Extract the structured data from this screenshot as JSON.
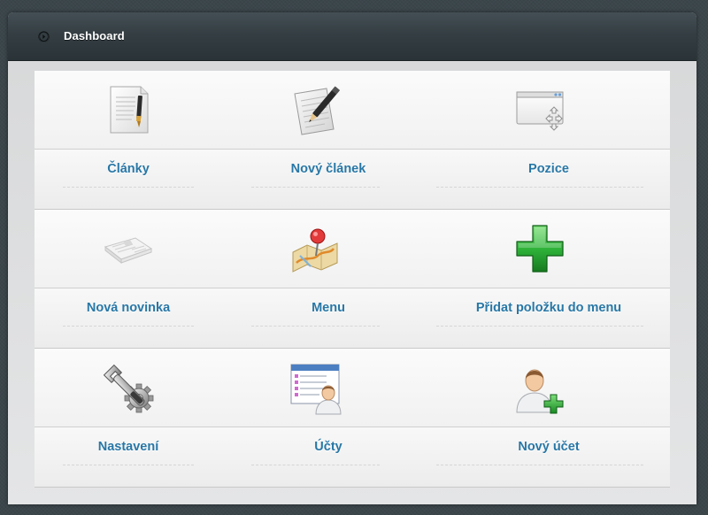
{
  "header": {
    "title": "Dashboard",
    "icon": "circle-arrow-icon"
  },
  "colors": {
    "header_bg": "#343e43",
    "link": "#2877a6",
    "page_bg": "#3b464b"
  },
  "tiles": [
    [
      {
        "name": "clanky",
        "label": "Články",
        "icon": "document-pen-icon"
      },
      {
        "name": "novy-clanek",
        "label": "Nový článek",
        "icon": "notepad-pencil-icon"
      },
      {
        "name": "pozice",
        "label": "Pozice",
        "icon": "window-arrows-icon"
      }
    ],
    [
      {
        "name": "nova-novinka",
        "label": "Nová novinka",
        "icon": "newspaper-icon"
      },
      {
        "name": "menu",
        "label": "Menu",
        "icon": "map-pin-icon"
      },
      {
        "name": "pridat-polozku",
        "label": "Přidat položku do menu",
        "icon": "green-plus-icon"
      }
    ],
    [
      {
        "name": "nastaveni",
        "label": "Nastavení",
        "icon": "wrench-gear-icon"
      },
      {
        "name": "ucty",
        "label": "Účty",
        "icon": "user-list-icon"
      },
      {
        "name": "novy-ucet",
        "label": "Nový účet",
        "icon": "user-add-icon"
      }
    ]
  ]
}
